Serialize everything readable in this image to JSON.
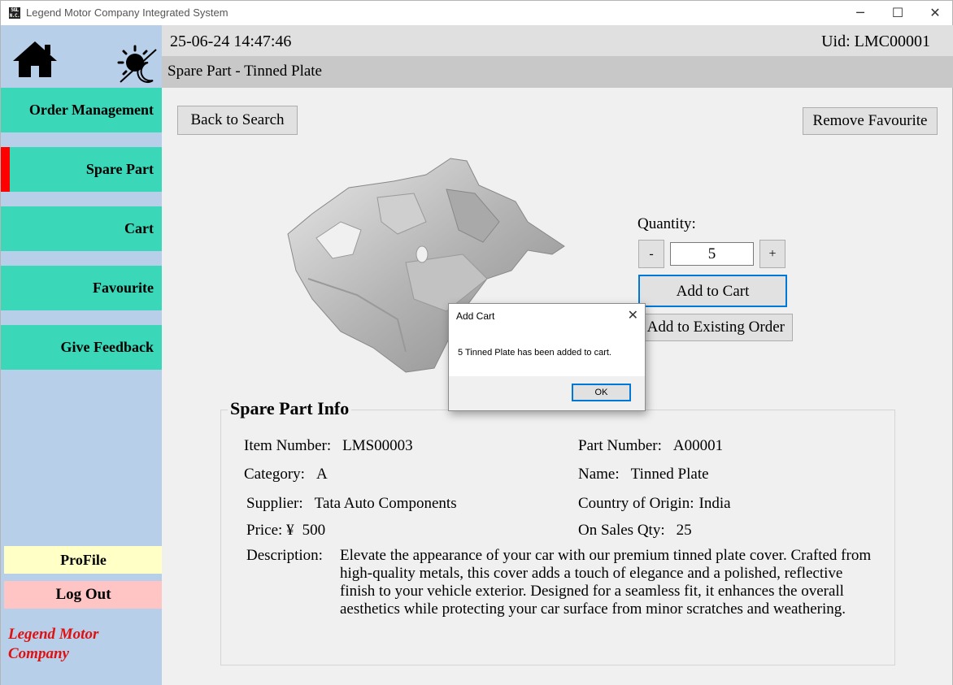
{
  "window": {
    "title": "Legend Motor Company Integrated System",
    "icon_text": "SGL\nN.C.",
    "minimize_glyph": "─",
    "maximize_glyph": "☐",
    "close_glyph": "✕"
  },
  "sidebar": {
    "home_icon": "home-icon",
    "theme_icon": "sun-moon-icon",
    "items": [
      {
        "label": "Order Management",
        "active": false
      },
      {
        "label": "Spare Part",
        "active": true
      },
      {
        "label": "Cart",
        "active": false
      },
      {
        "label": "Favourite",
        "active": false
      },
      {
        "label": "Give Feedback",
        "active": false
      }
    ],
    "profile_label": "ProFile",
    "logout_label": "Log Out",
    "brand_line1": "Legend Motor",
    "brand_line2": "Company",
    "active_color": "#ff0000",
    "nav_color": "#3ad7b8"
  },
  "header": {
    "datetime": "25-06-24 14:47:46",
    "uid": "Uid: LMC00001",
    "page_title": "Spare Part - Tinned Plate"
  },
  "actions": {
    "back_label": "Back to Search",
    "remove_fav_label": "Remove Favourite"
  },
  "quantity": {
    "label": "Quantity:",
    "minus": "-",
    "plus": "+",
    "value": "5",
    "add_cart_label": "Add to Cart",
    "add_existing_label": "Add to Existing Order"
  },
  "info": {
    "title": "Spare Part Info",
    "item_number_label": "Item Number:",
    "item_number": "LMS00003",
    "category_label": "Category:",
    "category": "A",
    "supplier_label": "Supplier:",
    "supplier": "Tata Auto Components",
    "price_label": "Price: ¥",
    "price": "500",
    "part_number_label": "Part Number:",
    "part_number": "A00001",
    "name_label": "Name:",
    "name": "Tinned Plate",
    "country_label": "Country of Origin:",
    "country": "India",
    "on_sale_label": "On Sales Qty:",
    "on_sale": "25",
    "description_label": "Description:",
    "description": "Elevate the appearance of your car with our premium tinned plate cover. Crafted from high-quality metals, this cover adds a touch of elegance and a polished, reflective finish to your vehicle exterior. Designed for a seamless fit, it enhances the overall aesthetics while protecting your car surface from minor scratches and weathering."
  },
  "dialog": {
    "title": "Add Cart",
    "message": "5 Tinned Plate has been added to cart.",
    "ok_label": "OK",
    "close_glyph": "✕"
  }
}
